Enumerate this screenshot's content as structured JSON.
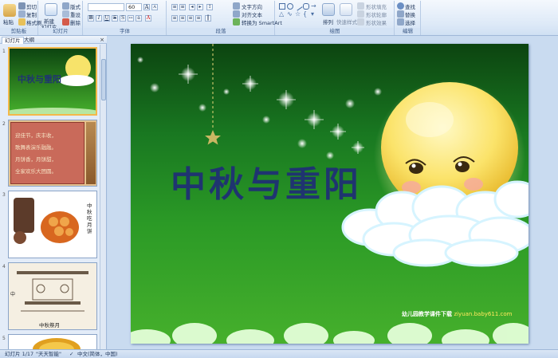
{
  "ribbon": {
    "clipboard": {
      "label": "剪贴板",
      "paste": "粘贴",
      "cut": "剪切",
      "copy": "复制",
      "format_painter": "格式刷"
    },
    "slides": {
      "label": "幻灯片",
      "new_slide": "新建",
      "new_slide_sub": "幻灯片",
      "layout": "版式",
      "reset": "重设",
      "delete": "删除"
    },
    "font": {
      "label": "字体",
      "font_size": "60",
      "grow": "A",
      "shrink": "A"
    },
    "paragraph": {
      "label": "段落",
      "text_direction": "文字方向",
      "align_text": "对齐文本",
      "smartart": "转换为 SmartArt"
    },
    "drawing": {
      "label": "绘图",
      "arrange": "排列",
      "quick_styles": "快速样式",
      "shape_fill": "形状填充",
      "shape_outline": "形状轮廓",
      "shape_effects": "形状效果"
    },
    "editing": {
      "label": "编辑",
      "find": "查找",
      "replace": "替换",
      "select": "选择"
    }
  },
  "panel": {
    "tabs": [
      "幻灯片",
      "大纲"
    ],
    "close": "×",
    "slides": [
      {
        "num": "1",
        "title": "中秋与重阳"
      },
      {
        "num": "2",
        "lines": [
          "迎佳节，庆丰收，",
          "歌舞表演乐融融。",
          "月饼香，月饼甜，",
          "全家欢乐大团圆。"
        ]
      },
      {
        "num": "3",
        "caption": "中秋吃月饼"
      },
      {
        "num": "4",
        "caption": "中秋祭月",
        "side": "中"
      },
      {
        "num": "5"
      }
    ]
  },
  "slide": {
    "title": "中秋与重阳",
    "credit_prefix": "幼儿园教学课件下载 ",
    "credit_url": "ziyuan.baby611.com"
  },
  "status": {
    "slide_count": "幻灯片 1/17",
    "theme": "\"天天智能\"",
    "language": "中文(简体，中国)"
  },
  "colors": {
    "accent": "#f4b84a",
    "title": "#1f3470",
    "ribbon": "#dde9f7"
  }
}
